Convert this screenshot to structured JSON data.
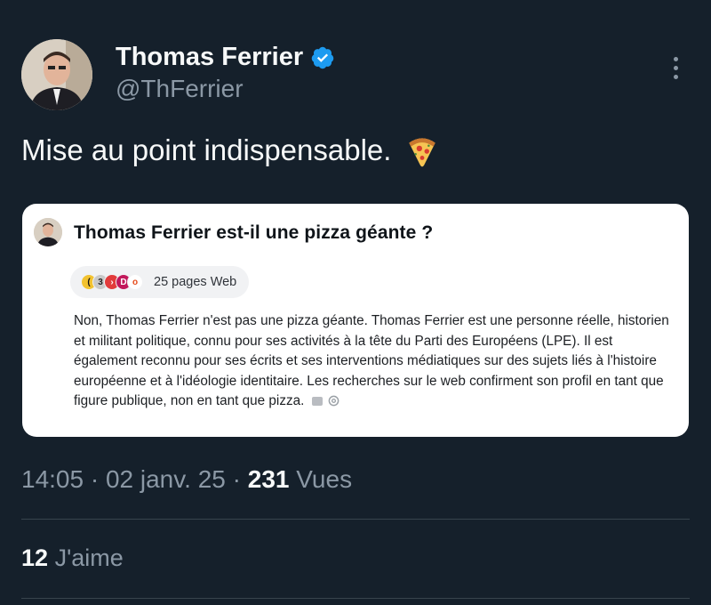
{
  "author": {
    "display_name": "Thomas Ferrier",
    "handle": "@ThFerrier",
    "verified": true
  },
  "tweet": {
    "text": "Mise au point indispensable."
  },
  "quoted_card": {
    "title": "Thomas Ferrier est-il une pizza géante ?",
    "sources_label": "25 pages Web",
    "answer": "Non, Thomas Ferrier n'est pas une pizza géante. Thomas Ferrier est une personne réelle, historien et militant politique, connu pour ses activités à la tête du Parti des Européens (LPE). Il est également reconnu pour ses écrits et ses interventions médiatiques sur des sujets liés à l'histoire européenne et à l'idéologie identitaire. Les recherches sur le web confirment son profil en tant que figure publique, non en tant que pizza."
  },
  "meta": {
    "time": "14:05",
    "sep1": "·",
    "date": "02 janv. 25",
    "sep2": "·",
    "views_count": "231",
    "views_label": "Vues"
  },
  "engagement": {
    "likes_count": "12",
    "likes_label": "J'aime"
  },
  "colors": {
    "background": "#15202b",
    "primary_text": "#f7f9f9",
    "secondary_text": "#8b98a5",
    "verified_blue": "#1d9bf0",
    "divider": "#38444d"
  },
  "icons": [
    "avatar",
    "verified-badge-icon",
    "more-options-icon",
    "pizza-emoji-icon",
    "source-favicon-icons"
  ]
}
